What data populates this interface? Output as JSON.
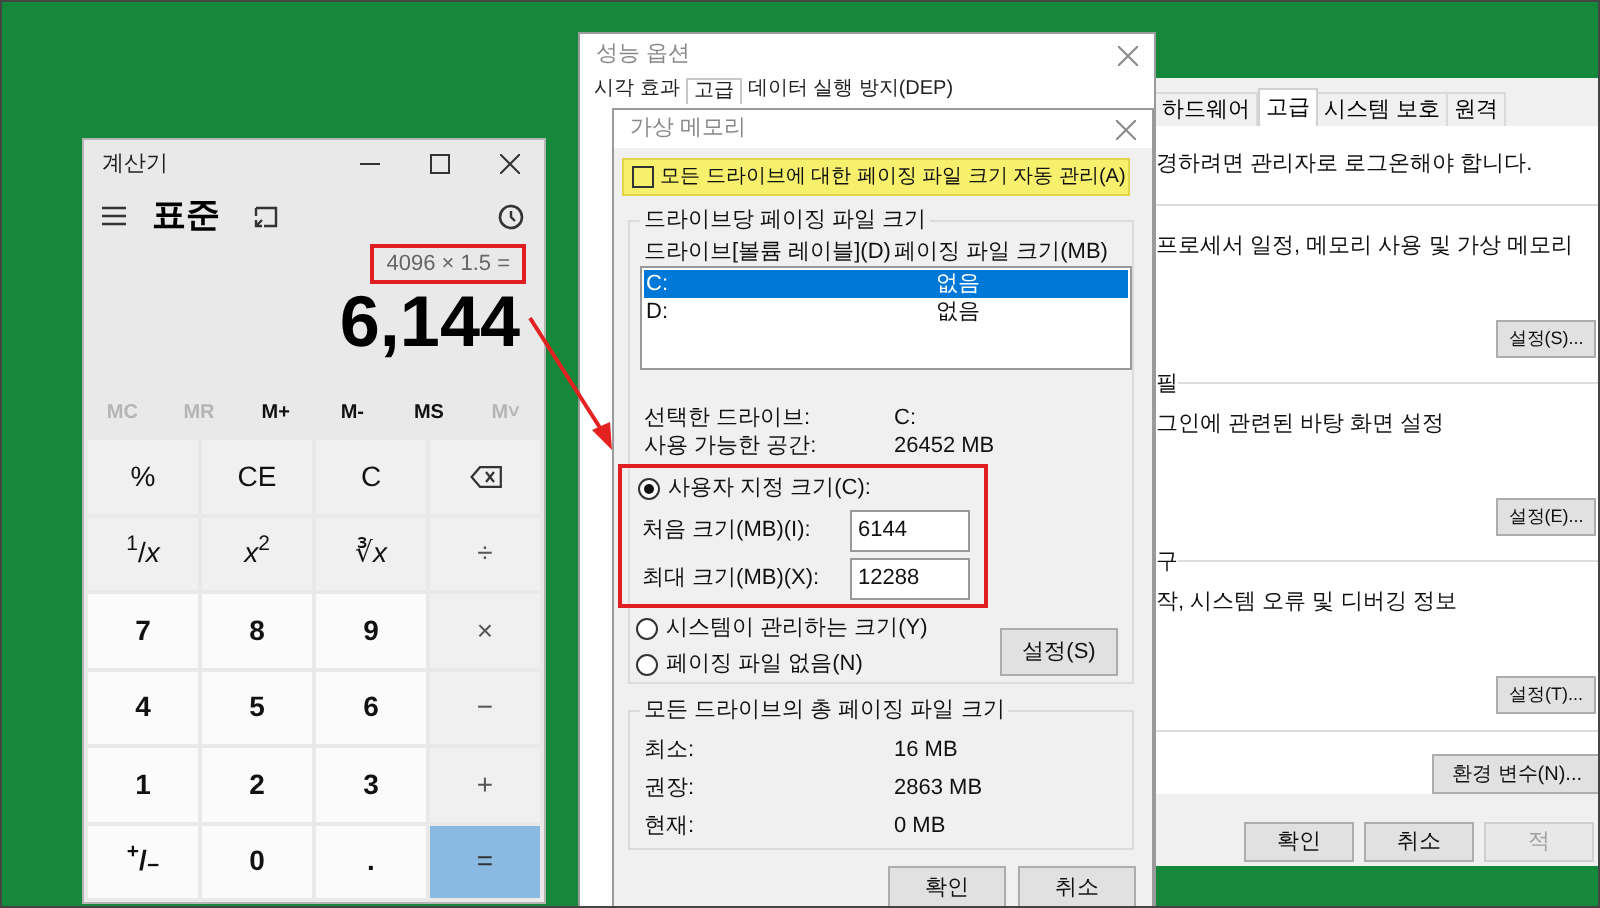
{
  "calculator": {
    "title": "계산기",
    "mode": "표준",
    "expression": "4096 × 1.5 =",
    "result": "6,144",
    "memory": [
      {
        "label": "MC",
        "disabled": true
      },
      {
        "label": "MR",
        "disabled": true
      },
      {
        "label": "M+",
        "disabled": false
      },
      {
        "label": "M-",
        "disabled": false
      },
      {
        "label": "MS",
        "disabled": false
      },
      {
        "label": "M˅",
        "disabled": true
      }
    ],
    "keys": [
      {
        "kind": "function",
        "label": "%"
      },
      {
        "kind": "function",
        "label": "CE"
      },
      {
        "kind": "function",
        "label": "C"
      },
      {
        "kind": "backspace"
      },
      {
        "kind": "function",
        "label": "$^{1}$/*x*"
      },
      {
        "kind": "function",
        "label": "*x*$^{2}$"
      },
      {
        "kind": "function",
        "label": "∛*x*"
      },
      {
        "kind": "operator",
        "label": "÷"
      },
      {
        "kind": "digit",
        "label": "7"
      },
      {
        "kind": "digit",
        "label": "8"
      },
      {
        "kind": "digit",
        "label": "9"
      },
      {
        "kind": "operator",
        "label": "×"
      },
      {
        "kind": "digit",
        "label": "4"
      },
      {
        "kind": "digit",
        "label": "5"
      },
      {
        "kind": "digit",
        "label": "6"
      },
      {
        "kind": "operator",
        "label": "−"
      },
      {
        "kind": "digit",
        "label": "1"
      },
      {
        "kind": "digit",
        "label": "2"
      },
      {
        "kind": "digit",
        "label": "3"
      },
      {
        "kind": "operator",
        "label": "+"
      },
      {
        "kind": "digit",
        "label": "$^{+}$/$_{−}$"
      },
      {
        "kind": "digit",
        "label": "0"
      },
      {
        "kind": "digit",
        "label": "."
      },
      {
        "kind": "equals",
        "label": "="
      }
    ]
  },
  "system_properties": {
    "tabs": [
      {
        "label": "하드웨어",
        "selected": false
      },
      {
        "label": "고급",
        "selected": true
      },
      {
        "label": "시스템 보호",
        "selected": false
      },
      {
        "label": "원격",
        "selected": false
      }
    ],
    "notice": "경하려면 관리자로 로그온해야 합니다.",
    "sections": [
      {
        "description": "프로세서 일정, 메모리 사용 및 가상 메모리",
        "button": "설정(S)..."
      },
      {
        "heading": "필",
        "description": "그인에 관련된 바탕 화면 설정",
        "button": "설정(E)..."
      },
      {
        "heading": "구",
        "description": "작, 시스템 오류 및 디버깅 정보",
        "button": "설정(T)..."
      }
    ],
    "environment_button": "환경 변수(N)...",
    "buttons": [
      {
        "label": "확인",
        "disabled": false
      },
      {
        "label": "취소",
        "disabled": false
      },
      {
        "label": "적",
        "disabled": true
      }
    ]
  },
  "performance_options": {
    "title": "성능 옵션",
    "tabs": [
      {
        "label": "시각 효과",
        "selected": false
      },
      {
        "label": "고급",
        "selected": true
      },
      {
        "label": "데이터 실행 방지(DEP)",
        "selected": false
      }
    ]
  },
  "virtual_memory": {
    "title": "가상 메모리",
    "auto_manage": {
      "label": "모든 드라이브에 대한 페이징 파일 크기 자동 관리(A)",
      "checked": false
    },
    "per_drive_group": "드라이브당 페이징 파일 크기",
    "columns": [
      "드라이브[볼륨 레이블](D)",
      "페이징 파일 크기(MB)"
    ],
    "drives": [
      {
        "drive": "C:",
        "size": "없음",
        "selected": true
      },
      {
        "drive": "D:",
        "size": "없음",
        "selected": false
      }
    ],
    "selected_drive": {
      "label": "선택한 드라이브:",
      "value": "C:"
    },
    "free_space": {
      "label": "사용 가능한 공간:",
      "value": "26452 MB"
    },
    "options": [
      {
        "label": "사용자 지정 크기(C):",
        "selected": true
      },
      {
        "label": "시스템이 관리하는 크기(Y)",
        "selected": false
      },
      {
        "label": "페이징 파일 없음(N)",
        "selected": false
      }
    ],
    "initial_size": {
      "label": "처음 크기(MB)(I):",
      "value": "6144"
    },
    "maximum_size": {
      "label": "최대 크기(MB)(X):",
      "value": "12288"
    },
    "set_button": "설정(S)",
    "total_group": "모든 드라이브의 총 페이징 파일 크기",
    "totals": [
      {
        "label": "최소:",
        "value": "16 MB"
      },
      {
        "label": "권장:",
        "value": "2863 MB"
      },
      {
        "label": "현재:",
        "value": "0 MB"
      }
    ],
    "buttons": [
      "확인",
      "취소"
    ]
  }
}
